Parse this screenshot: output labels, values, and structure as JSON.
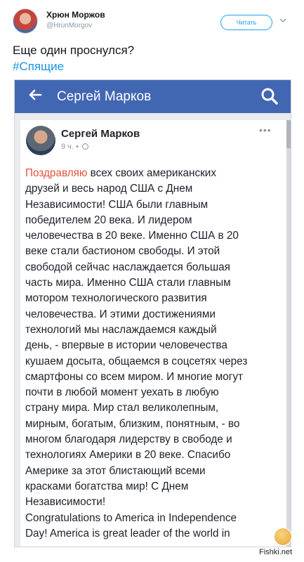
{
  "tweet": {
    "author_name": "Хрюн Моржов",
    "author_handle": "@HrunMorgov",
    "follow_label": "Читать",
    "text": "Еще один проснулся?",
    "hashtag": "#Спящие"
  },
  "embedded": {
    "page_title": "Сергей Марков",
    "post": {
      "author": "Сергей Марков",
      "time": "9 ч. •",
      "more": "•••",
      "highlight": "Поздравляю",
      "body": " всех своих американских\nдрузей и весь народ США с Днем\nНезависимости! США были главным\nпобедителем 20 века. И лидером\nчеловечества в 20 веке. Именно США в 20\nвеке стали бастионом свободы. И этой\nсвободой сейчас наслаждается большая\nчасть мира.   Именно США стали главным\nмотором технологического развития\nчеловечества. И этими достижениями\nтехнологий мы наслаждаемся каждый\nдень, - впервые в истории человечества\nкушаем досыта, общаемся в соцсетях через\nсмартфоны со всем миром. И многие могут\nпочти в любой момент уехать в любую\nстрану мира. Мир стал великолепным,\nмирным, богатым, близким, понятным,  - во\nмногом благодаря лидерству в свободе и\nтехнологиях Америки в 20 веке. Спасибо\nАмерике за этот блистающий всеми\nкрасками богатства мир! С Днем\nНезависимости!\nCongratulations to America in Independence\nDay! America is great leader of the world in"
    }
  },
  "watermark": "Fishki.net",
  "colors": {
    "facebook_blue": "#4267b2",
    "twitter_blue": "#1da1f2",
    "highlight": "#e0533c"
  }
}
